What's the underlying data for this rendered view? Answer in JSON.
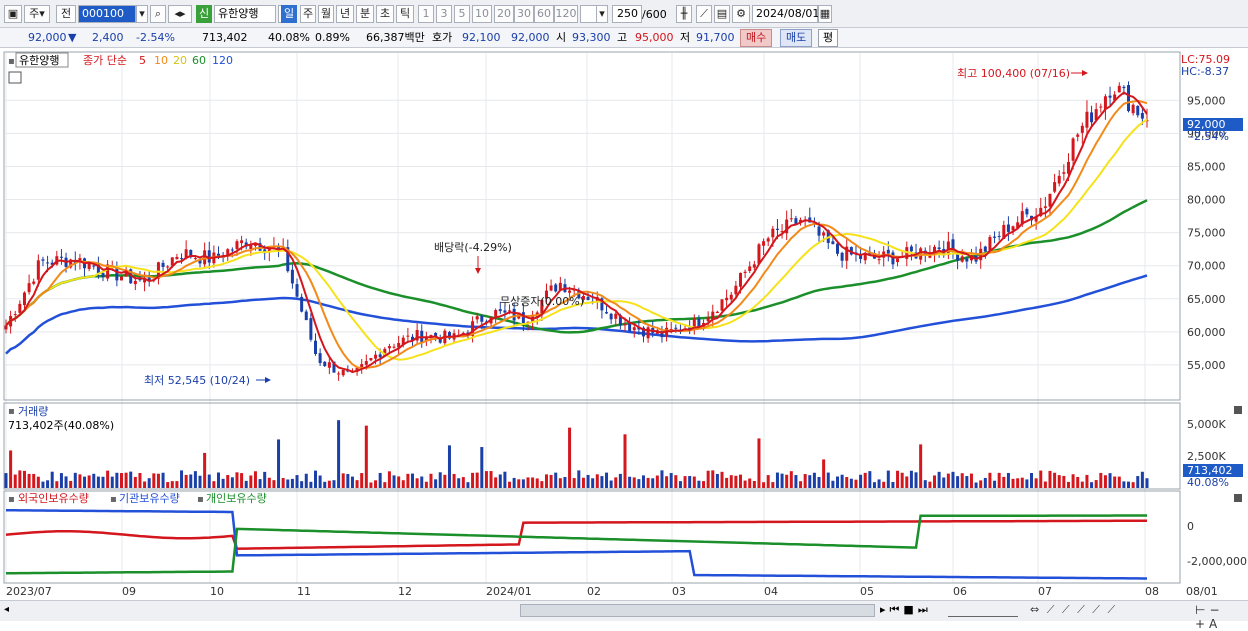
{
  "toolbar": {
    "market": "주",
    "jeon": "전",
    "code": "000100",
    "name_badge": "신",
    "name": "유한양행",
    "period_tabs": [
      "일",
      "주",
      "월",
      "년",
      "분",
      "초",
      "틱"
    ],
    "num_tabs": [
      "1",
      "3",
      "5",
      "10",
      "20",
      "30",
      "60",
      "120"
    ],
    "count": "250",
    "count_total": "/600",
    "date": "2024/08/01"
  },
  "info": {
    "price": "92,000",
    "change": "2,400",
    "change_pct": "-2.54%",
    "volume": "713,402",
    "vol_ratio": "40.08%",
    "turnover": "0.89%",
    "amount": "66,387백만",
    "hoga_label": "호가",
    "bid": "92,100",
    "ask": "92,000",
    "open_label": "시",
    "open": "93,300",
    "high_label": "고",
    "high": "95,000",
    "low_label": "저",
    "low": "91,700",
    "buy": "매수",
    "sell": "매도",
    "flat": "평"
  },
  "price_panel": {
    "title": "유한양행",
    "ma_label": "종가 단순",
    "ma_periods": [
      "5",
      "10",
      "20",
      "60",
      "120"
    ],
    "lc": "LC:75.09",
    "hc": "HC:-8.37",
    "yticks": [
      "95,000",
      "90,000",
      "85,000",
      "80,000",
      "75,000",
      "70,000",
      "65,000",
      "60,000",
      "55,000"
    ],
    "current_price": "92,000",
    "current_pct": "-2.54%",
    "high_annotation": "최고 100,400 (07/16)",
    "low_annotation": "최저 52,545 (10/24)",
    "dividend_annotation": "배당락(-4.29%)",
    "rights_annotation": "무상증자(0.00%)"
  },
  "volume_panel": {
    "title": "거래량",
    "value": "713,402주(40.08%)",
    "yticks": [
      "5,000K",
      "2,500K"
    ],
    "current": "713,402",
    "current_pct": "40.08%"
  },
  "holding_panel": {
    "series_labels": [
      "외국인보유수량",
      "기관보유수량",
      "개인보유수량"
    ],
    "yticks": [
      "0",
      "-2,000,000"
    ]
  },
  "xaxis": [
    "2023/07",
    "09",
    "10",
    "11",
    "12",
    "2024/01",
    "02",
    "03",
    "04",
    "05",
    "06",
    "07",
    "08"
  ],
  "xaxis_right": "08/01",
  "colors": {
    "up": "#d4161d",
    "down": "#1a3fa8",
    "ma5": "#d4161d",
    "ma10": "#f28a1a",
    "ma20": "#f5e21a",
    "ma60": "#1b8f2a",
    "ma120": "#2350d8"
  },
  "chart_data": {
    "type": "candlestick",
    "title": "유한양행",
    "ylim": [
      50000,
      102000
    ],
    "x_start": "2023/07",
    "x_end": "2024/08/01",
    "ma_periods": [
      5,
      10,
      20,
      60,
      120
    ],
    "annotations": [
      {
        "label": "최고",
        "value": 100400,
        "date": "07/16"
      },
      {
        "label": "최저",
        "value": 52545,
        "date": "10/24"
      },
      {
        "label": "배당락",
        "pct": -4.29
      },
      {
        "label": "무상증자",
        "pct": 0.0
      }
    ],
    "close_path": [
      [
        "2023/07",
        61000
      ],
      [
        "2023/07",
        70500
      ],
      [
        "2023/08",
        71000
      ],
      [
        "2023/08",
        69000
      ],
      [
        "2023/09",
        67500
      ],
      [
        "2023/09",
        72000
      ],
      [
        "2023/09",
        71000
      ],
      [
        "2023/10",
        74000
      ],
      [
        "2023/10",
        72000
      ],
      [
        "2023/10",
        56000
      ],
      [
        "2023/10",
        53000
      ],
      [
        "2023/11",
        58000
      ],
      [
        "2023/11",
        59500
      ],
      [
        "2023/12",
        59000
      ],
      [
        "2023/12",
        63000
      ],
      [
        "2023/12",
        62000
      ],
      [
        "2024/01",
        67500
      ],
      [
        "2024/01",
        65000
      ],
      [
        "2024/01",
        61000
      ],
      [
        "2024/02",
        59500
      ],
      [
        "2024/02",
        61500
      ],
      [
        "2024/03",
        66000
      ],
      [
        "2024/03",
        74000
      ],
      [
        "2024/04",
        77000
      ],
      [
        "2024/04",
        72000
      ],
      [
        "2024/05",
        71000
      ],
      [
        "2024/05",
        71500
      ],
      [
        "2024/06",
        73000
      ],
      [
        "2024/06",
        71000
      ],
      [
        "2024/06",
        76000
      ],
      [
        "2024/07",
        79000
      ],
      [
        "2024/07",
        90000
      ],
      [
        "2024/07",
        97500
      ],
      [
        "2024/08/01",
        92000
      ]
    ],
    "volume_current": 713402,
    "volume_ylim": [
      0,
      6000000
    ]
  }
}
